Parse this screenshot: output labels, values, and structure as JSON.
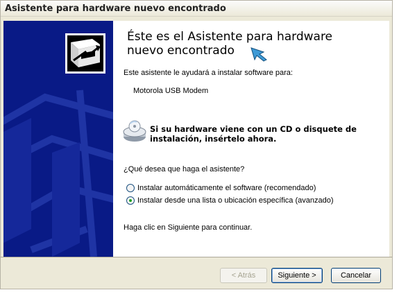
{
  "window": {
    "title": "Asistente para hardware nuevo encontrado"
  },
  "content": {
    "heading": "Éste es el Asistente para hardware nuevo encontrado",
    "intro": "Este asistente le ayudará a instalar software para:",
    "device": "Motorola USB Modem",
    "cd_hint": "Si su hardware viene con un CD o disquete de instalación, insértelo ahora.",
    "question": "¿Qué desea que haga el asistente?",
    "options": [
      {
        "label": "Instalar automáticamente el software (recomendado)",
        "selected": false
      },
      {
        "label": "Instalar desde una lista o ubicación específica (avanzado)",
        "selected": true
      }
    ],
    "footer_hint": "Haga clic en Siguiente para continuar."
  },
  "buttons": {
    "back": "< Atrás",
    "next": "Siguiente >",
    "cancel": "Cancelar"
  },
  "colors": {
    "sidebar": "#091a86",
    "accent": "#003c74",
    "radio_dot": "#21a121"
  },
  "icons": [
    "hardware-wizard-icon",
    "cd-drive-icon",
    "pointer-cursor-icon"
  ]
}
